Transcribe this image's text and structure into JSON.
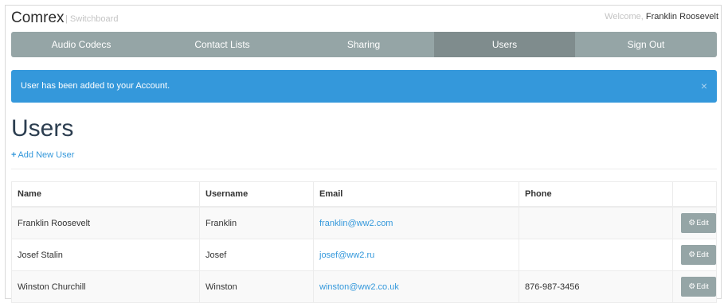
{
  "header": {
    "brand": "Comrex",
    "brand_sub": "| Switchboard",
    "welcome_label": "Welcome, ",
    "user_name": "Franklin Roosevelt"
  },
  "nav": {
    "items": [
      {
        "label": "Audio Codecs",
        "active": false
      },
      {
        "label": "Contact Lists",
        "active": false
      },
      {
        "label": "Sharing",
        "active": false
      },
      {
        "label": "Users",
        "active": true
      },
      {
        "label": "Sign Out",
        "active": false
      }
    ]
  },
  "alert": {
    "message": "User has been added to your Account.",
    "close": "×"
  },
  "page": {
    "title": "Users",
    "add_user": "Add New User",
    "add_icon": "plus-icon"
  },
  "table": {
    "headers": {
      "name": "Name",
      "username": "Username",
      "email": "Email",
      "phone": "Phone"
    },
    "edit_label": "Edit",
    "edit_icon": "gear-icon",
    "rows": [
      {
        "name": "Franklin Roosevelt",
        "username": "Franklin",
        "email": "franklin@ww2.com",
        "phone": ""
      },
      {
        "name": "Josef Stalin",
        "username": "Josef",
        "email": "josef@ww2.ru",
        "phone": ""
      },
      {
        "name": "Winston Churchill",
        "username": "Winston",
        "email": "winston@ww2.co.uk",
        "phone": "876-987-3456"
      }
    ]
  },
  "colors": {
    "nav_bg": "#95a5a6",
    "nav_active": "#7f8c8d",
    "alert_bg": "#3498db",
    "link": "#3498db",
    "title": "#2c3e50"
  }
}
